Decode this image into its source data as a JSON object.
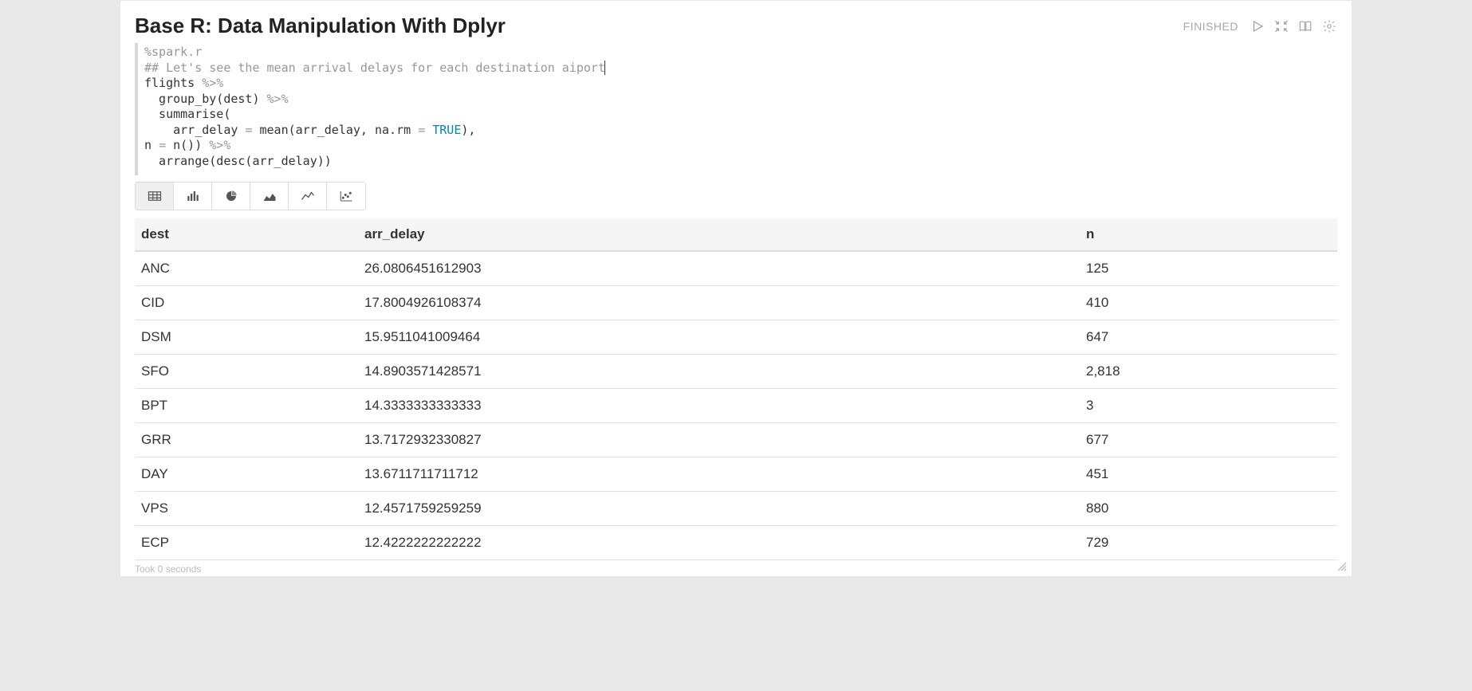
{
  "paragraph": {
    "title": "Base R: Data Manipulation With Dplyr",
    "status": "FINISHED",
    "footer": "Took 0 seconds"
  },
  "code": {
    "interpreter": "%spark.r",
    "comment": "## Let's see the mean arrival delays for each destination aiport",
    "l3": "flights ",
    "pipe": "%>%",
    "l4a": "  group_by(dest) ",
    "l5": "  summarise(",
    "l6a": "    arr_delay ",
    "eq": "=",
    "l6b": " mean(arr_delay, na.rm ",
    "true": "TRUE",
    "l6c": "),",
    "l7a": "n ",
    "l7b": " n()) ",
    "l8": "  arrange(desc(arr_delay))"
  },
  "controls": {
    "run": "run-icon",
    "collapse": "collapse-icon",
    "book": "book-icon",
    "gear": "gear-icon"
  },
  "viz": {
    "buttons": [
      "table",
      "bar",
      "pie",
      "area",
      "line",
      "scatter"
    ],
    "active": "table"
  },
  "table": {
    "columns": [
      "dest",
      "arr_delay",
      "n"
    ],
    "rows": [
      {
        "dest": "ANC",
        "arr_delay": "26.0806451612903",
        "n": "125"
      },
      {
        "dest": "CID",
        "arr_delay": "17.8004926108374",
        "n": "410"
      },
      {
        "dest": "DSM",
        "arr_delay": "15.9511041009464",
        "n": "647"
      },
      {
        "dest": "SFO",
        "arr_delay": "14.8903571428571",
        "n": "2,818"
      },
      {
        "dest": "BPT",
        "arr_delay": "14.3333333333333",
        "n": "3"
      },
      {
        "dest": "GRR",
        "arr_delay": "13.7172932330827",
        "n": "677"
      },
      {
        "dest": "DAY",
        "arr_delay": "13.6711711711712",
        "n": "451"
      },
      {
        "dest": "VPS",
        "arr_delay": "12.4571759259259",
        "n": "880"
      },
      {
        "dest": "ECP",
        "arr_delay": "12.4222222222222",
        "n": "729"
      }
    ]
  }
}
